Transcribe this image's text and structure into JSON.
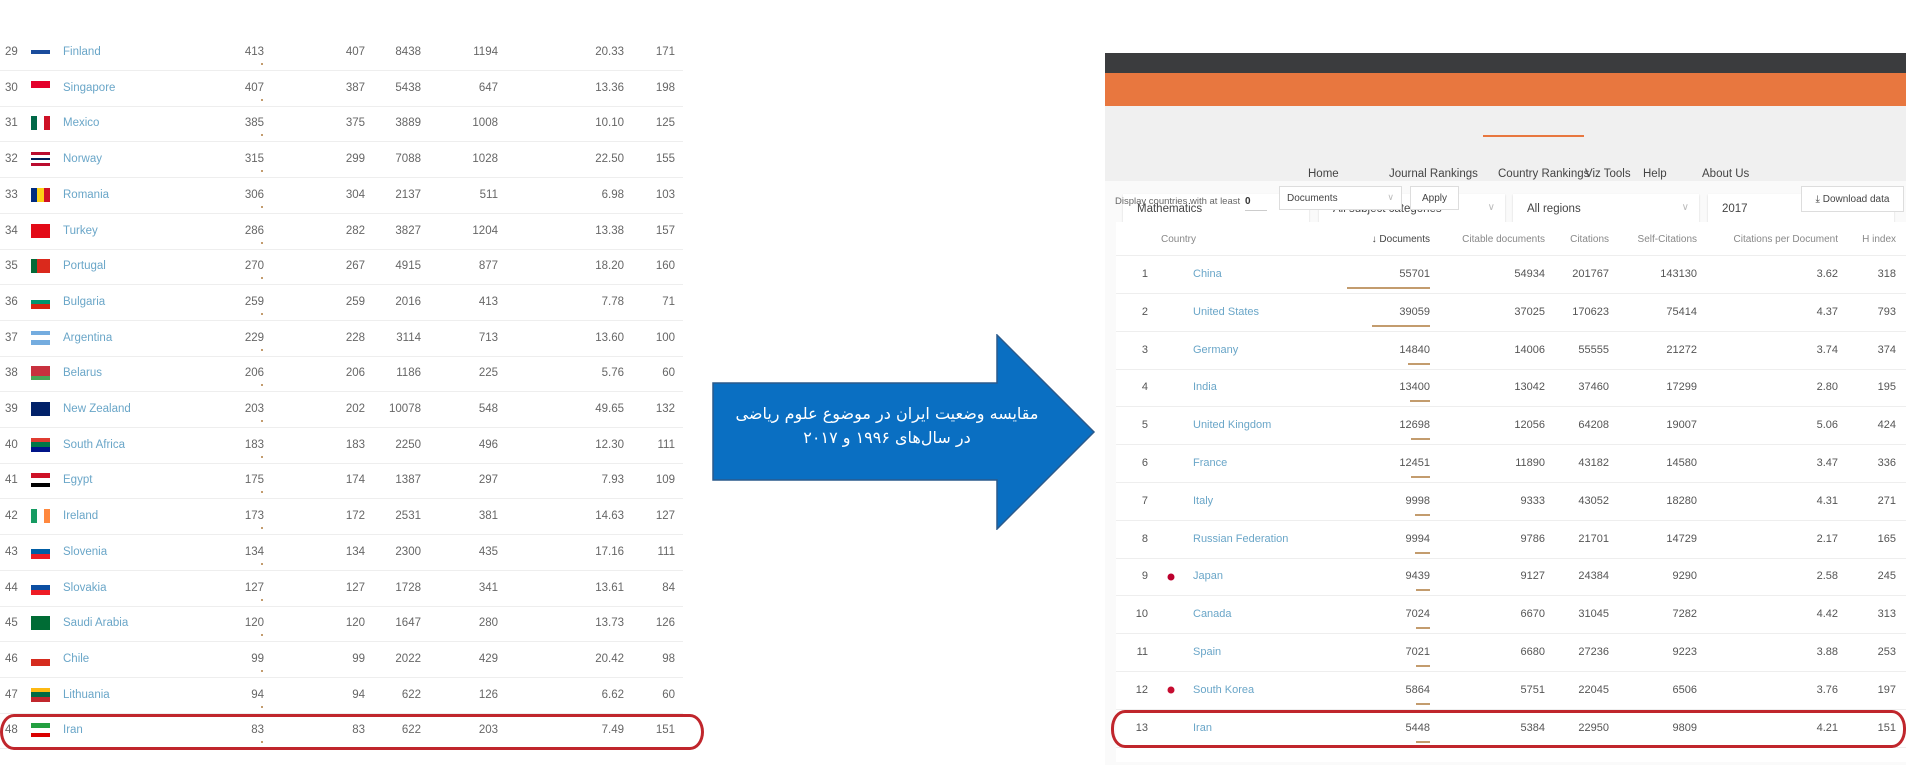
{
  "left_table": {
    "rows": [
      {
        "rank": "29",
        "country": "Finland",
        "documents": "413",
        "citable": "407",
        "citations": "8438",
        "self_citations": "1194",
        "cpd": "20.33",
        "h_index": "171",
        "flag": {
          "dir": "h",
          "colors": [
            "#fff",
            "#1a4c9c",
            "#fff"
          ]
        }
      },
      {
        "rank": "30",
        "country": "Singapore",
        "documents": "407",
        "citable": "387",
        "citations": "5438",
        "self_citations": "647",
        "cpd": "13.36",
        "h_index": "198",
        "flag": {
          "dir": "h",
          "colors": [
            "#e4002b",
            "#fff"
          ]
        }
      },
      {
        "rank": "31",
        "country": "Mexico",
        "documents": "385",
        "citable": "375",
        "citations": "3889",
        "self_citations": "1008",
        "cpd": "10.10",
        "h_index": "125",
        "flag": {
          "dir": "v",
          "colors": [
            "#006847",
            "#fff",
            "#ce1126"
          ]
        }
      },
      {
        "rank": "32",
        "country": "Norway",
        "documents": "315",
        "citable": "299",
        "citations": "7088",
        "self_citations": "1028",
        "cpd": "22.50",
        "h_index": "155",
        "flag": {
          "dir": "h",
          "colors": [
            "#ba0c2f",
            "#fff",
            "#00205b",
            "#fff",
            "#ba0c2f"
          ]
        }
      },
      {
        "rank": "33",
        "country": "Romania",
        "documents": "306",
        "citable": "304",
        "citations": "2137",
        "self_citations": "511",
        "cpd": "6.98",
        "h_index": "103",
        "flag": {
          "dir": "v",
          "colors": [
            "#002b7f",
            "#fcd116",
            "#ce1126"
          ]
        }
      },
      {
        "rank": "34",
        "country": "Turkey",
        "documents": "286",
        "citable": "282",
        "citations": "3827",
        "self_citations": "1204",
        "cpd": "13.38",
        "h_index": "157",
        "flag": {
          "dir": "h",
          "colors": [
            "#e30a17"
          ]
        }
      },
      {
        "rank": "35",
        "country": "Portugal",
        "documents": "270",
        "citable": "267",
        "citations": "4915",
        "self_citations": "877",
        "cpd": "18.20",
        "h_index": "160",
        "flag": {
          "dir": "v",
          "colors": [
            "#046a38",
            "#da291c",
            "#da291c"
          ]
        }
      },
      {
        "rank": "36",
        "country": "Bulgaria",
        "documents": "259",
        "citable": "259",
        "citations": "2016",
        "self_citations": "413",
        "cpd": "7.78",
        "h_index": "71",
        "flag": {
          "dir": "h",
          "colors": [
            "#fff",
            "#00966e",
            "#d62612"
          ]
        }
      },
      {
        "rank": "37",
        "country": "Argentina",
        "documents": "229",
        "citable": "228",
        "citations": "3114",
        "self_citations": "713",
        "cpd": "13.60",
        "h_index": "100",
        "flag": {
          "dir": "h",
          "colors": [
            "#74acdf",
            "#fff",
            "#74acdf"
          ]
        }
      },
      {
        "rank": "38",
        "country": "Belarus",
        "documents": "206",
        "citable": "206",
        "citations": "1186",
        "self_citations": "225",
        "cpd": "5.76",
        "h_index": "60",
        "flag": {
          "dir": "h",
          "colors": [
            "#c8313e",
            "#c8313e",
            "#4aa657"
          ]
        }
      },
      {
        "rank": "39",
        "country": "New Zealand",
        "documents": "203",
        "citable": "202",
        "citations": "10078",
        "self_citations": "548",
        "cpd": "49.65",
        "h_index": "132",
        "flag": {
          "dir": "h",
          "colors": [
            "#012169"
          ]
        }
      },
      {
        "rank": "40",
        "country": "South Africa",
        "documents": "183",
        "citable": "183",
        "citations": "2250",
        "self_citations": "496",
        "cpd": "12.30",
        "h_index": "111",
        "flag": {
          "dir": "h",
          "colors": [
            "#e03c31",
            "#007749",
            "#001489"
          ]
        }
      },
      {
        "rank": "41",
        "country": "Egypt",
        "documents": "175",
        "citable": "174",
        "citations": "1387",
        "self_citations": "297",
        "cpd": "7.93",
        "h_index": "109",
        "flag": {
          "dir": "h",
          "colors": [
            "#ce1126",
            "#fff",
            "#000"
          ]
        }
      },
      {
        "rank": "42",
        "country": "Ireland",
        "documents": "173",
        "citable": "172",
        "citations": "2531",
        "self_citations": "381",
        "cpd": "14.63",
        "h_index": "127",
        "flag": {
          "dir": "v",
          "colors": [
            "#169b62",
            "#fff",
            "#ff883e"
          ]
        }
      },
      {
        "rank": "43",
        "country": "Slovenia",
        "documents": "134",
        "citable": "134",
        "citations": "2300",
        "self_citations": "435",
        "cpd": "17.16",
        "h_index": "111",
        "flag": {
          "dir": "h",
          "colors": [
            "#fff",
            "#005da4",
            "#ed1c24"
          ]
        }
      },
      {
        "rank": "44",
        "country": "Slovakia",
        "documents": "127",
        "citable": "127",
        "citations": "1728",
        "self_citations": "341",
        "cpd": "13.61",
        "h_index": "84",
        "flag": {
          "dir": "h",
          "colors": [
            "#fff",
            "#0b4ea2",
            "#ee1c25"
          ]
        }
      },
      {
        "rank": "45",
        "country": "Saudi Arabia",
        "documents": "120",
        "citable": "120",
        "citations": "1647",
        "self_citations": "280",
        "cpd": "13.73",
        "h_index": "126",
        "flag": {
          "dir": "h",
          "colors": [
            "#006c35"
          ]
        }
      },
      {
        "rank": "46",
        "country": "Chile",
        "documents": "99",
        "citable": "99",
        "citations": "2022",
        "self_citations": "429",
        "cpd": "20.42",
        "h_index": "98",
        "flag": {
          "dir": "h",
          "colors": [
            "#fff",
            "#d52b1e"
          ]
        }
      },
      {
        "rank": "47",
        "country": "Lithuania",
        "documents": "94",
        "citable": "94",
        "citations": "622",
        "self_citations": "126",
        "cpd": "6.62",
        "h_index": "60",
        "flag": {
          "dir": "h",
          "colors": [
            "#fdb913",
            "#006a44",
            "#c1272d"
          ]
        }
      },
      {
        "rank": "48",
        "country": "Iran",
        "documents": "83",
        "citable": "83",
        "citations": "622",
        "self_citations": "203",
        "cpd": "7.49",
        "h_index": "151",
        "flag": {
          "dir": "h",
          "colors": [
            "#239f40",
            "#fff",
            "#da0000"
          ]
        }
      }
    ]
  },
  "arrow": {
    "text_line1": "مقایسه وضعیت ایران در موضوع علوم ریاضی",
    "text_line2": "در سال‌های ۱۹۹۶ و ۲۰۱۷",
    "color": "#0a6fc2"
  },
  "highlight_color": "#c0262c",
  "right_panel": {
    "nav": [
      "Home",
      "Journal Rankings",
      "Country Rankings",
      "Viz Tools",
      "Help",
      "About Us"
    ],
    "active_nav": "Country Rankings",
    "brand_color": "#e8773f",
    "dropdowns": {
      "area": "Mathematics",
      "category": "All subject categories",
      "region": "All regions",
      "year": "2017"
    },
    "filter": {
      "label": "Display countries with at least",
      "value": "0",
      "metric": "Documents",
      "apply": "Apply",
      "download": "Download data"
    },
    "headers": {
      "country": "Country",
      "documents": "↓ Documents",
      "citable": "Citable documents",
      "citations": "Citations",
      "self_citations": "Self-Citations",
      "cpd": "Citations per Document",
      "h_index": "H index"
    },
    "rows": [
      {
        "rank": "1",
        "country": "China",
        "documents": "55701",
        "citable": "54934",
        "citations": "201767",
        "self_citations": "143130",
        "cpd": "3.62",
        "h_index": "318",
        "flag": {
          "dir": "h",
          "colors": [
            "#de2910"
          ]
        }
      },
      {
        "rank": "2",
        "country": "United States",
        "documents": "39059",
        "citable": "37025",
        "citations": "170623",
        "self_citations": "75414",
        "cpd": "4.37",
        "h_index": "793",
        "flag": {
          "dir": "h",
          "colors": [
            "#b22234",
            "#fff",
            "#b22234",
            "#fff",
            "#b22234"
          ]
        }
      },
      {
        "rank": "3",
        "country": "Germany",
        "documents": "14840",
        "citable": "14006",
        "citations": "55555",
        "self_citations": "21272",
        "cpd": "3.74",
        "h_index": "374",
        "flag": {
          "dir": "h",
          "colors": [
            "#000",
            "#dd0000",
            "#ffce00"
          ]
        }
      },
      {
        "rank": "4",
        "country": "India",
        "documents": "13400",
        "citable": "13042",
        "citations": "37460",
        "self_citations": "17299",
        "cpd": "2.80",
        "h_index": "195",
        "flag": {
          "dir": "h",
          "colors": [
            "#ff9933",
            "#fff",
            "#138808"
          ]
        }
      },
      {
        "rank": "5",
        "country": "United Kingdom",
        "documents": "12698",
        "citable": "12056",
        "citations": "64208",
        "self_citations": "19007",
        "cpd": "5.06",
        "h_index": "424",
        "flag": {
          "dir": "h",
          "colors": [
            "#012169",
            "#c8102e",
            "#012169"
          ]
        }
      },
      {
        "rank": "6",
        "country": "France",
        "documents": "12451",
        "citable": "11890",
        "citations": "43182",
        "self_citations": "14580",
        "cpd": "3.47",
        "h_index": "336",
        "flag": {
          "dir": "v",
          "colors": [
            "#0055a4",
            "#fff",
            "#ef4135"
          ]
        }
      },
      {
        "rank": "7",
        "country": "Italy",
        "documents": "9998",
        "citable": "9333",
        "citations": "43052",
        "self_citations": "18280",
        "cpd": "4.31",
        "h_index": "271",
        "flag": {
          "dir": "v",
          "colors": [
            "#009246",
            "#fff",
            "#ce2b37"
          ]
        }
      },
      {
        "rank": "8",
        "country": "Russian Federation",
        "documents": "9994",
        "citable": "9786",
        "citations": "21701",
        "self_citations": "14729",
        "cpd": "2.17",
        "h_index": "165",
        "flag": {
          "dir": "h",
          "colors": [
            "#fff",
            "#0039a6",
            "#d52b1e"
          ]
        }
      },
      {
        "rank": "9",
        "country": "Japan",
        "documents": "9439",
        "citable": "9127",
        "citations": "24384",
        "self_citations": "9290",
        "cpd": "2.58",
        "h_index": "245",
        "flag": {
          "dir": "h",
          "colors": [
            "#fff"
          ],
          "dot": "#bc002d"
        }
      },
      {
        "rank": "10",
        "country": "Canada",
        "documents": "7024",
        "citable": "6670",
        "citations": "31045",
        "self_citations": "7282",
        "cpd": "4.42",
        "h_index": "313",
        "flag": {
          "dir": "v",
          "colors": [
            "#d80621",
            "#fff",
            "#d80621"
          ]
        }
      },
      {
        "rank": "11",
        "country": "Spain",
        "documents": "7021",
        "citable": "6680",
        "citations": "27236",
        "self_citations": "9223",
        "cpd": "3.88",
        "h_index": "253",
        "flag": {
          "dir": "h",
          "colors": [
            "#aa151b",
            "#f1bf00",
            "#f1bf00",
            "#aa151b"
          ]
        }
      },
      {
        "rank": "12",
        "country": "South Korea",
        "documents": "5864",
        "citable": "5751",
        "citations": "22045",
        "self_citations": "6506",
        "cpd": "3.76",
        "h_index": "197",
        "flag": {
          "dir": "h",
          "colors": [
            "#fff"
          ],
          "dot": "#c60c30"
        }
      },
      {
        "rank": "13",
        "country": "Iran",
        "documents": "5448",
        "citable": "5384",
        "citations": "22950",
        "self_citations": "9809",
        "cpd": "4.21",
        "h_index": "151",
        "flag": {
          "dir": "h",
          "colors": [
            "#239f40",
            "#fff",
            "#da0000"
          ]
        }
      }
    ]
  }
}
